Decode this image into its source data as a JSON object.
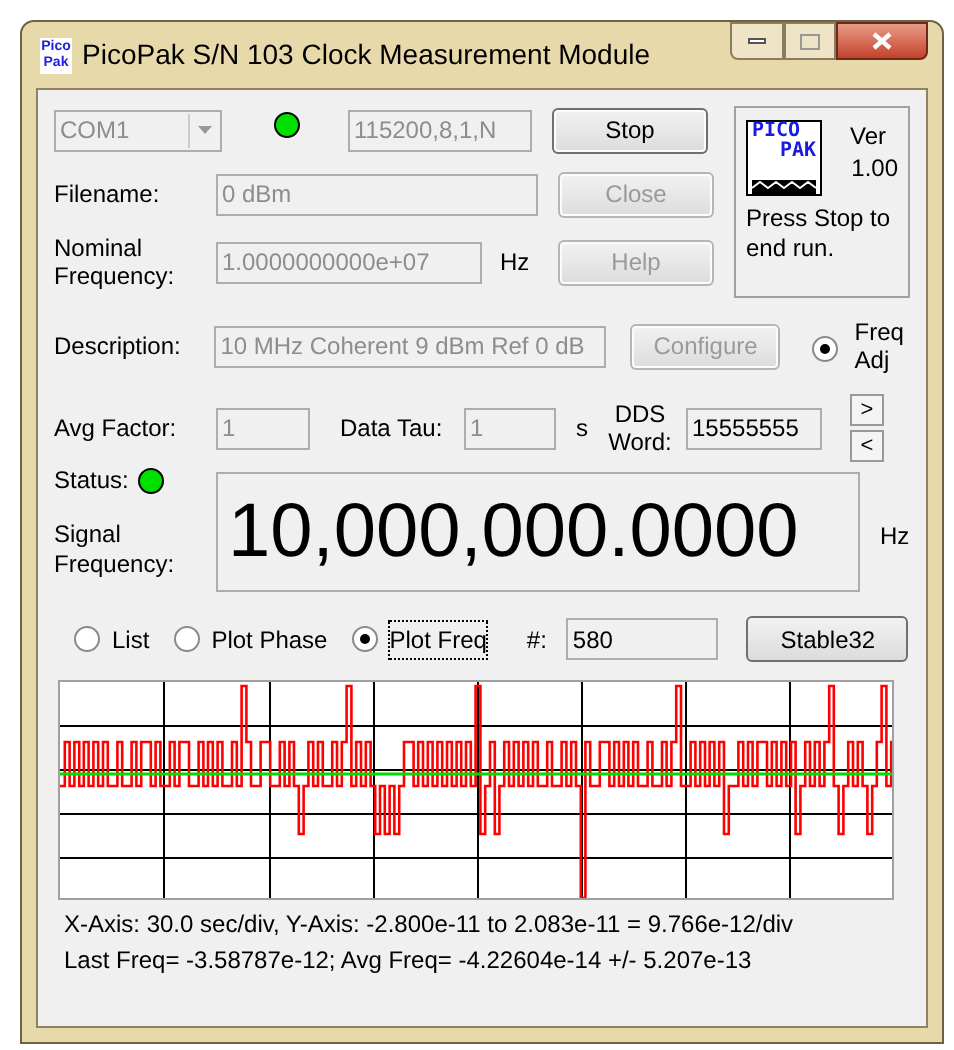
{
  "window": {
    "title": "PicoPak S/N 103 Clock Measurement Module",
    "icon_lines": [
      "Pico",
      "Pak"
    ]
  },
  "port": {
    "value": "COM1",
    "disabled": true
  },
  "link_led": {
    "on": true
  },
  "serial_settings": {
    "value": "115200,8,1,N",
    "disabled": true
  },
  "buttons": [
    {
      "label": "Stop",
      "disabled": false
    },
    {
      "label": "Close",
      "disabled": true
    },
    {
      "label": "Help",
      "disabled": true
    }
  ],
  "filename": {
    "label": "Filename:",
    "value": "0 dBm",
    "disabled": true
  },
  "nominal_frequency": {
    "label": "Nominal Frequency:",
    "value": "1.0000000000e+07",
    "disabled": true,
    "unit": "Hz"
  },
  "logo_panel": {
    "logo_lines": [
      "PICO",
      "PAK"
    ],
    "version_label": "Ver",
    "version": "1.00",
    "message": "Press Stop to end run."
  },
  "description": {
    "label": "Description:",
    "value": "10 MHz Coherent 9 dBm Ref 0 dB",
    "disabled": true,
    "configure_button": {
      "label": "Configure",
      "disabled": true
    },
    "freq_adj": {
      "label": "Freq Adj",
      "selected": true
    }
  },
  "avg_factor": {
    "label": "Avg Factor:",
    "value": "1"
  },
  "data_tau": {
    "label": "Data Tau:",
    "value": "1",
    "unit": "s"
  },
  "dds_word": {
    "label": "DDS Word:",
    "value": "15555555",
    "up_button": ">",
    "down_button": "<"
  },
  "status": {
    "label": "Status:",
    "on": true
  },
  "signal_frequency": {
    "label": "Signal Frequency:",
    "value": "10,000,000.0000",
    "unit": "Hz"
  },
  "display_modes": [
    {
      "label": "List",
      "selected": false
    },
    {
      "label": "Plot Phase",
      "selected": false
    },
    {
      "label": "Plot Freq",
      "selected": true
    }
  ],
  "count": {
    "label": "#:",
    "value": "580"
  },
  "stable32_button": {
    "label": "Stable32"
  },
  "plot_info": [
    "X-Axis: 30.0 sec/div, Y-Axis: -2.800e-11 to 2.083e-11 = 9.766e-12/div",
    "Last Freq= -3.58787e-12; Avg Freq= -4.22604e-14 +/- 5.207e-13"
  ]
}
